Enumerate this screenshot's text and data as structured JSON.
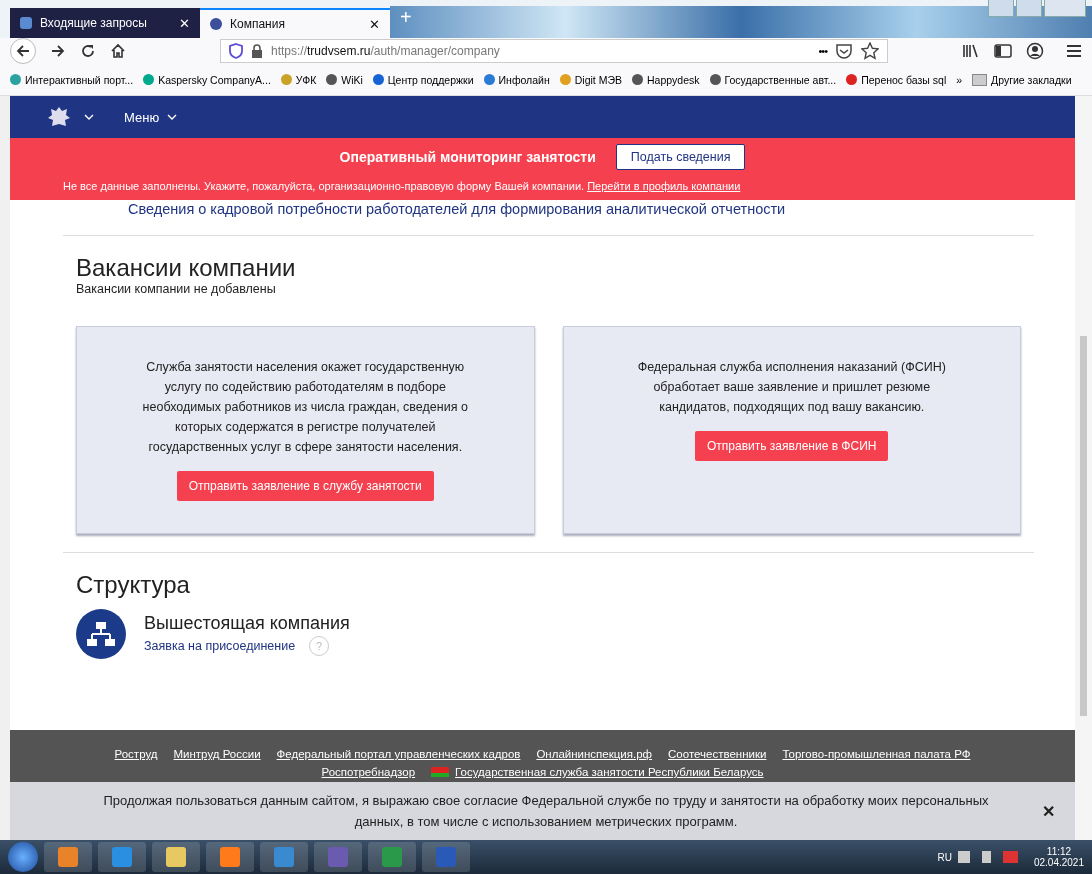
{
  "browser": {
    "tabs": [
      {
        "title": "Входящие запросы",
        "close": "✕",
        "selected": false
      },
      {
        "title": "Компания",
        "close": "✕",
        "selected": true
      }
    ],
    "new_tab": "+",
    "url": {
      "scheme": "https://",
      "domain": "trudvsem.ru",
      "path": "/auth/manager/company"
    },
    "url_more": "•••",
    "bookmarks": [
      {
        "label": "Интерактивный порт..."
      },
      {
        "label": "Kaspersky CompanyA..."
      },
      {
        "label": "УФК"
      },
      {
        "label": "WiKi"
      },
      {
        "label": "Центр поддержки"
      },
      {
        "label": "Инфолайн"
      },
      {
        "label": "Digit МЭВ"
      },
      {
        "label": "Happydesk"
      },
      {
        "label": "Государственные авт..."
      },
      {
        "label": "Перенос базы sql"
      }
    ],
    "bookmarks_overflow": "»",
    "other_bookmarks": "Другие закладки"
  },
  "site_header": {
    "menu": "Меню"
  },
  "alert": {
    "title": "Оперативный мониторинг занятости",
    "button": "Подать сведения",
    "message": "Не все данные заполнены. Укажите, пожалуйста, организационно-правовую форму Вашей компании.",
    "link": "Перейти в профиль компании"
  },
  "report_link": "Сведения о кадровой потребности работодателей для формирования аналитической отчетности",
  "vacancies": {
    "title": "Вакансии компании",
    "empty": "Вакансии компании не добавлены",
    "cards": [
      {
        "text": "Служба занятости населения окажет государственную услугу по содействию работодателям в подборе необходимых работников из числа граждан, сведения о которых содержатся в регистре получателей государственных услуг в сфере занятости населения.",
        "button": "Отправить заявление в службу занятости"
      },
      {
        "text": "Федеральная служба исполнения наказаний (ФСИН) обработает ваше заявление и пришлет резюме кандидатов, подходящих под вашу вакансию.",
        "button": "Отправить заявление в ФСИН"
      }
    ]
  },
  "structure": {
    "title": "Структура",
    "parent": "Вышестоящая компания",
    "join_link": "Заявка на присоединение",
    "help": "?"
  },
  "footer": {
    "links": [
      "Роструд",
      "Минтруд России",
      "Федеральный портал управленческих кадров",
      "Онлайнинспекция.рф",
      "Соотечественники",
      "Торгово-промышленная палата РФ",
      "Роспотребнадзор",
      "Государственная служба занятости Республики Беларусь"
    ]
  },
  "cookie": {
    "text": "Продолжая пользоваться данным сайтом, я выражаю свое согласие Федеральной службе по труду и занятости на обработку моих персональных данных, в том числе с использованием метрических программ.",
    "close": "✕"
  },
  "taskbar": {
    "language": "RU",
    "time": "11:12",
    "date": "02.04.2021"
  }
}
